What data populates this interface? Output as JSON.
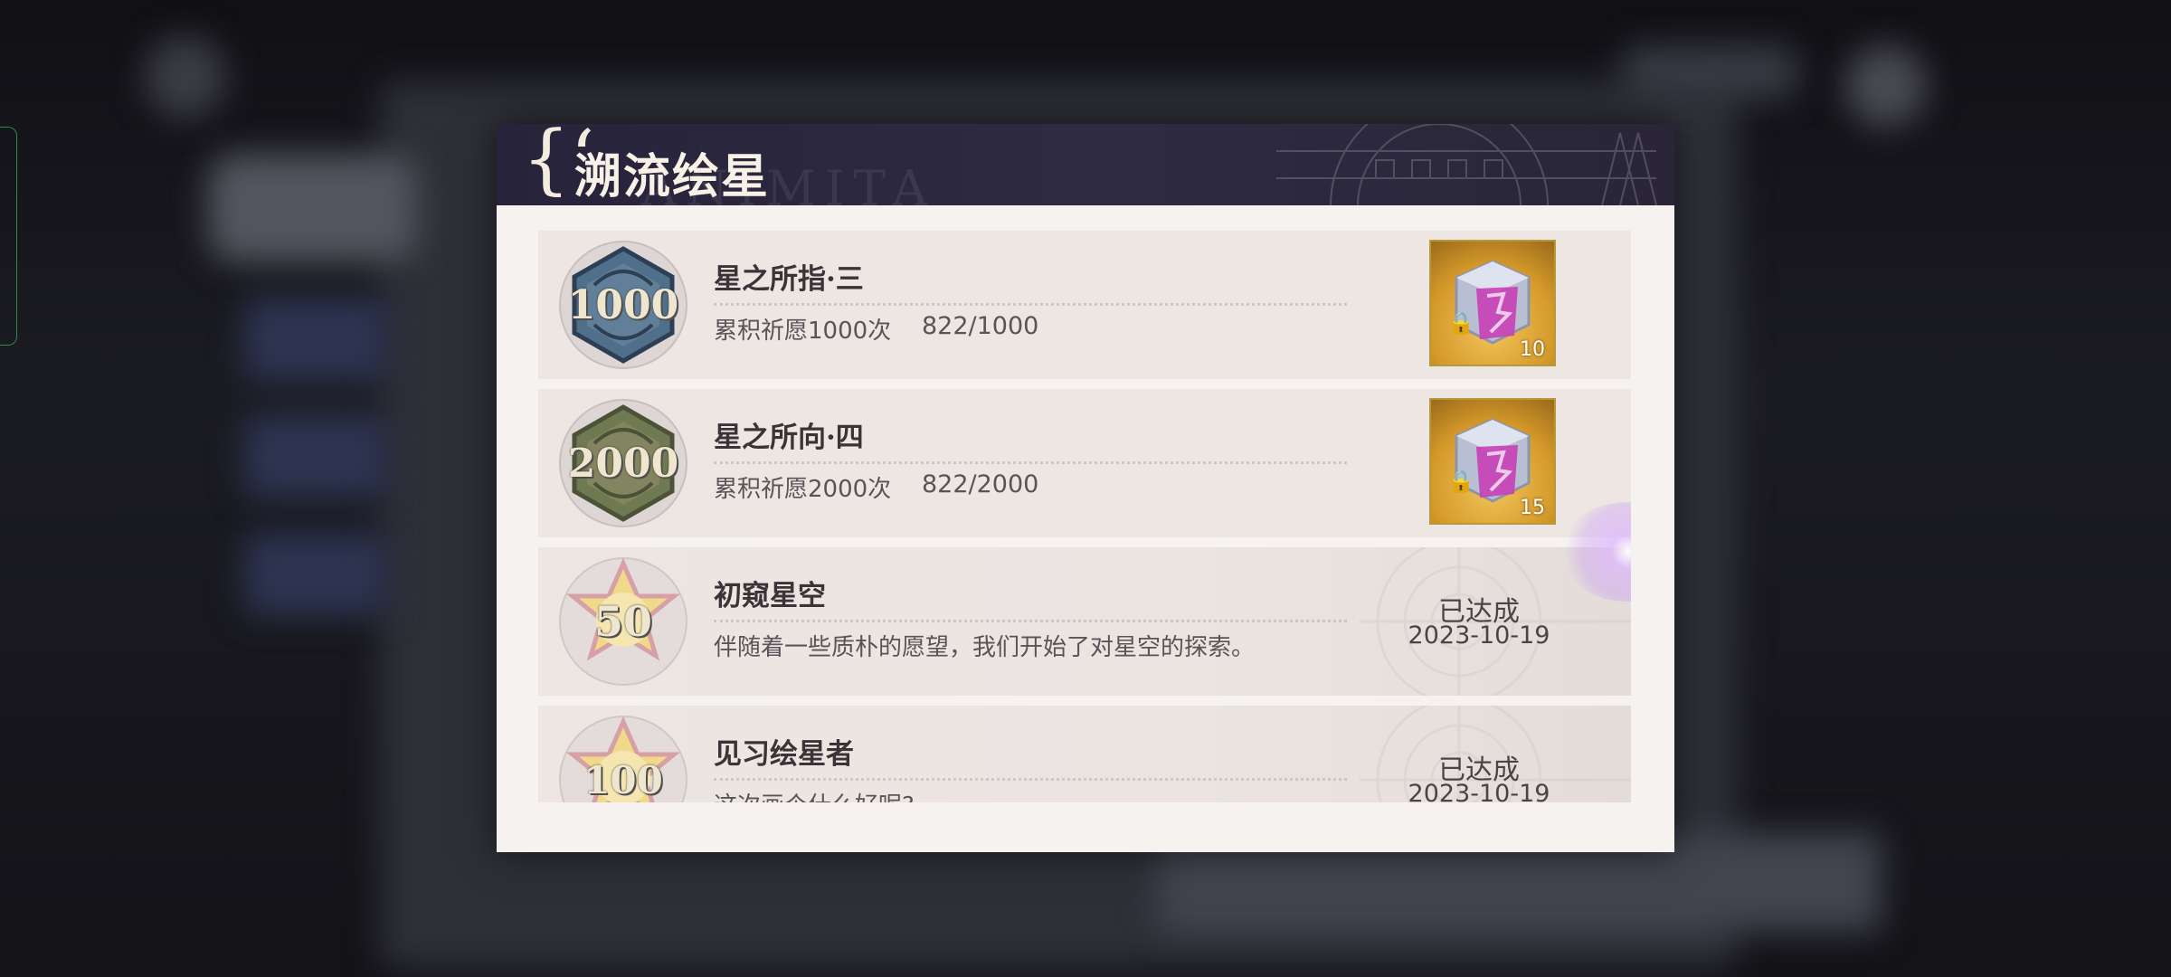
{
  "dialog": {
    "title": "溯流绘星",
    "title_brace": "{‘"
  },
  "achievements": [
    {
      "badge_value": "1000",
      "title": "星之所指·三",
      "description": "累积祈愿1000次",
      "progress": "822/1000",
      "reward_count": "10",
      "status": "in-progress"
    },
    {
      "badge_value": "2000",
      "title": "星之所向·四",
      "description": "累积祈愿2000次",
      "progress": "822/2000",
      "reward_count": "15",
      "status": "in-progress"
    },
    {
      "badge_value": "50",
      "title": "初窥星空",
      "description": "伴随着一些质朴的愿望，我们开始了对星空的探索。",
      "status_label": "已达成",
      "date": "2023-10-19",
      "status": "completed"
    },
    {
      "badge_value": "100",
      "title": "见习绘星者",
      "description": "这次画个什么好呢?",
      "status_label": "已达成",
      "date": "2023-10-19",
      "status": "completed"
    }
  ],
  "colors": {
    "header_bg": "#27233a",
    "panel_bg": "#f6f2ef",
    "row_bg": "#ede6e3",
    "reward_gold": "#d3982a",
    "text": "#3a3439"
  },
  "icons": {
    "reward": "locked-crystal-cube-icon",
    "lock": "lock-icon"
  }
}
